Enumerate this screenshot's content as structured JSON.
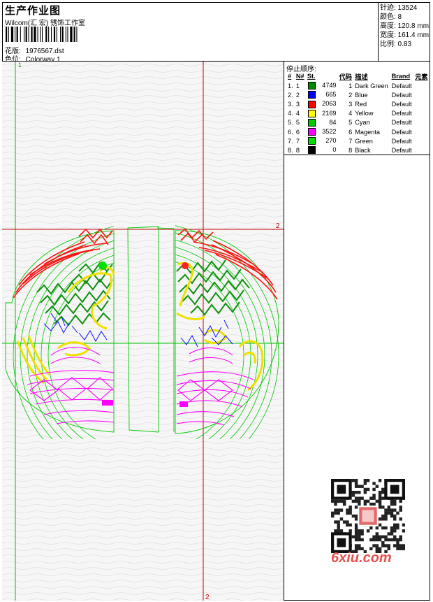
{
  "header": {
    "title": "生产作业图",
    "subtitle": "Wilcom(汇 宏) 锈饰工作室",
    "design_label": "花版:",
    "design_value": "1976567.dst",
    "colorway_label": "色位:",
    "colorway_value": "Colorway 1"
  },
  "stats": {
    "stitches": "针迹: 13524",
    "colors": "颜色: 8",
    "height": "高度: 120.8 mm",
    "width": "宽度: 161.4 mm",
    "scale": "比例: 0.83"
  },
  "side": {
    "stop_sequence_label": "停止顺序:",
    "columns": [
      "#",
      "N#",
      "St.",
      "代码",
      "描述",
      "Brand",
      "元素"
    ],
    "rows": [
      {
        "idx": "1.",
        "n": "1",
        "color": "#008a00",
        "st": "4749",
        "code": "1",
        "desc": "Dark Green",
        "brand": "Default"
      },
      {
        "idx": "2.",
        "n": "2",
        "color": "#0000ff",
        "st": "665",
        "code": "2",
        "desc": "Blue",
        "brand": "Default"
      },
      {
        "idx": "3.",
        "n": "3",
        "color": "#ff0000",
        "st": "2063",
        "code": "3",
        "desc": "Red",
        "brand": "Default"
      },
      {
        "idx": "4.",
        "n": "4",
        "color": "#ffff00",
        "st": "2169",
        "code": "4",
        "desc": "Yellow",
        "brand": "Default"
      },
      {
        "idx": "5.",
        "n": "5",
        "color": "#00c800",
        "st": "84",
        "code": "5",
        "desc": "Cyan",
        "brand": "Default"
      },
      {
        "idx": "6.",
        "n": "6",
        "color": "#ff00ff",
        "st": "3522",
        "code": "6",
        "desc": "Magenta",
        "brand": "Default"
      },
      {
        "idx": "7.",
        "n": "7",
        "color": "#00e000",
        "st": "270",
        "code": "7",
        "desc": "Green",
        "brand": "Default"
      },
      {
        "idx": "8.",
        "n": "8",
        "color": "#000000",
        "st": "0",
        "code": "8",
        "desc": "Black",
        "brand": "Default"
      }
    ]
  },
  "canvas": {
    "guide_label_top": "1",
    "guide_label_right": "2",
    "guide_label_bottom": "2"
  },
  "watermark": {
    "text": "6xiu.com"
  }
}
